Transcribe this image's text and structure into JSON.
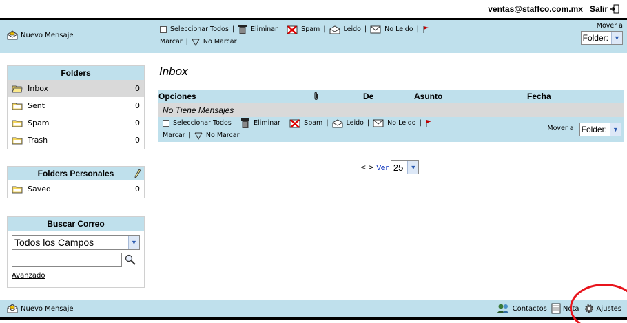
{
  "user": {
    "email": "ventas@staffco.com.mx",
    "logout_label": "Salir"
  },
  "toolbar": {
    "new_message": "Nuevo Mensaje",
    "select_all": "Seleccionar Todos",
    "delete": "Eliminar",
    "spam": "Spam",
    "read": "Leido",
    "unread": "No Leido",
    "mark": "Marcar",
    "unmark": "No Marcar",
    "sep": "|",
    "move_to": "Mover a",
    "folder_select": "Folder:"
  },
  "folders": {
    "title": "Folders",
    "items": [
      {
        "name": "Inbox",
        "count": "0"
      },
      {
        "name": "Sent",
        "count": "0"
      },
      {
        "name": "Spam",
        "count": "0"
      },
      {
        "name": "Trash",
        "count": "0"
      }
    ]
  },
  "personal_folders": {
    "title": "Folders Personales",
    "items": [
      {
        "name": "Saved",
        "count": "0"
      }
    ]
  },
  "search": {
    "title": "Buscar Correo",
    "field_select": "Todos los Campos",
    "input_value": "",
    "advanced": "Avanzado"
  },
  "main": {
    "title": "Inbox",
    "columns": {
      "options": "Opciones",
      "from": "De",
      "subject": "Asunto",
      "date": "Fecha"
    },
    "empty_text": "No Tiene Mensajes"
  },
  "pager": {
    "nav": "< >",
    "ver": "Ver",
    "per_page": "25"
  },
  "bottom": {
    "new_message": "Nuevo Mensaje",
    "contacts": "Contactos",
    "notes": "Nota",
    "settings": "Ajustes"
  },
  "colors": {
    "bar": "#bfe0ec",
    "highlight_circle": "#e8141c"
  }
}
